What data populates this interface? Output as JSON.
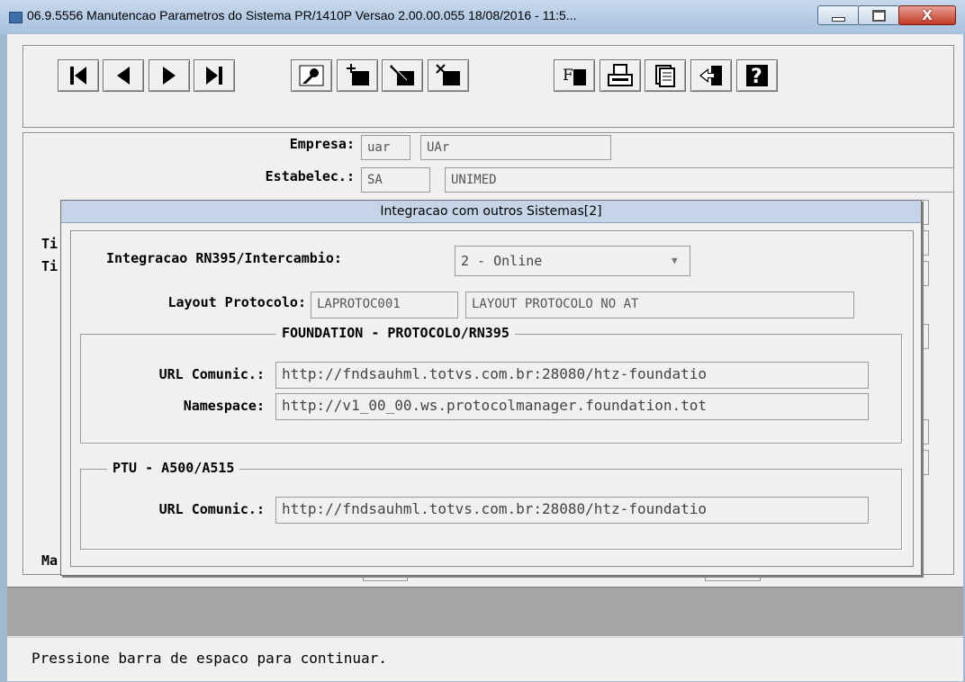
{
  "window": {
    "title": "06.9.5556 Manutencao  Parametros do Sistema PR/1410P Versao 2.00.00.055 18/08/2016 - 11:5...",
    "close_glyph": "X"
  },
  "toolbar": {
    "buttons": [
      {
        "name": "first-record",
        "icon": "first-icon"
      },
      {
        "name": "previous-record",
        "icon": "previous-icon"
      },
      {
        "name": "next-record",
        "icon": "next-icon"
      },
      {
        "name": "last-record",
        "icon": "last-icon"
      },
      {
        "name": "goto",
        "icon": "key-icon"
      },
      {
        "name": "add",
        "icon": "add-record-icon"
      },
      {
        "name": "modify",
        "icon": "edit-record-icon"
      },
      {
        "name": "delete",
        "icon": "delete-record-icon"
      },
      {
        "name": "filter",
        "icon": "filter-icon"
      },
      {
        "name": "print",
        "icon": "print-icon"
      },
      {
        "name": "copy",
        "icon": "copy-icon"
      },
      {
        "name": "exit",
        "icon": "exit-icon"
      },
      {
        "name": "help",
        "icon": "help-icon"
      }
    ],
    "filter_glyph": "F",
    "help_glyph": "?"
  },
  "form": {
    "empresa_label": "Empresa:",
    "empresa_code": "uar",
    "empresa_name": "UAr",
    "estabelec_label": "Estabelec.:",
    "estabelec_code": "SA",
    "estabelec_name": "UNIMED",
    "hidden_label_1": "Ti",
    "hidden_label_2": "Ti",
    "hidden_label_3": "Ma"
  },
  "dialog": {
    "title": "Integracao com outros Sistemas[2]",
    "integracao_label": "Integracao RN395/Intercambio:",
    "integracao_value": "2 - Online",
    "layout_label": "Layout Protocolo:",
    "layout_code": "LAPROTOC001",
    "layout_desc": "LAYOUT PROTOCOLO NO AT",
    "foundation_group": {
      "title": "FOUNDATION - PROTOCOLO/RN395",
      "url_label": "URL Comunic.:",
      "url_value": "http://fndsauhml.totvs.com.br:28080/htz-foundatio",
      "namespace_label": "Namespace:",
      "namespace_value": "http://v1_00_00.ws.protocolmanager.foundation.tot"
    },
    "ptu_group": {
      "title": "PTU - A500/A515",
      "url_label": "URL Comunic.:",
      "url_value": "http://fndsauhml.totvs.com.br:28080/htz-foundatio"
    }
  },
  "status": {
    "message": "Pressione barra de espaco para continuar."
  }
}
